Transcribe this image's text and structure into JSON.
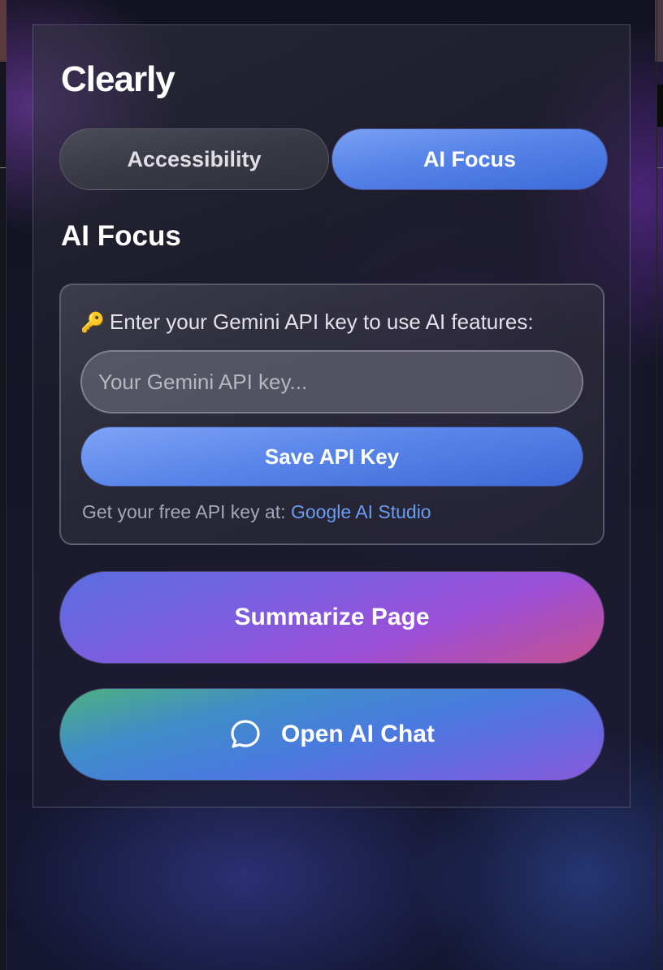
{
  "app": {
    "title": "Clearly"
  },
  "tabs": [
    {
      "label": "Accessibility",
      "active": false
    },
    {
      "label": "AI Focus",
      "active": true
    }
  ],
  "section": {
    "title": "AI Focus"
  },
  "api_key": {
    "icon": "key-icon",
    "prompt": "Enter your Gemini API key to use AI features:",
    "input_placeholder": "Your Gemini API key...",
    "input_value": "",
    "save_label": "Save API Key",
    "help_text": "Get your free API key at:",
    "help_link": "Google AI Studio"
  },
  "actions": {
    "summarize_label": "Summarize Page",
    "chat_label": "Open AI Chat",
    "chat_icon": "chat-bubble-icon"
  },
  "colors": {
    "accent_blue": "#5683e8",
    "link": "#6a9df0",
    "key_icon": "#d9a73a"
  }
}
